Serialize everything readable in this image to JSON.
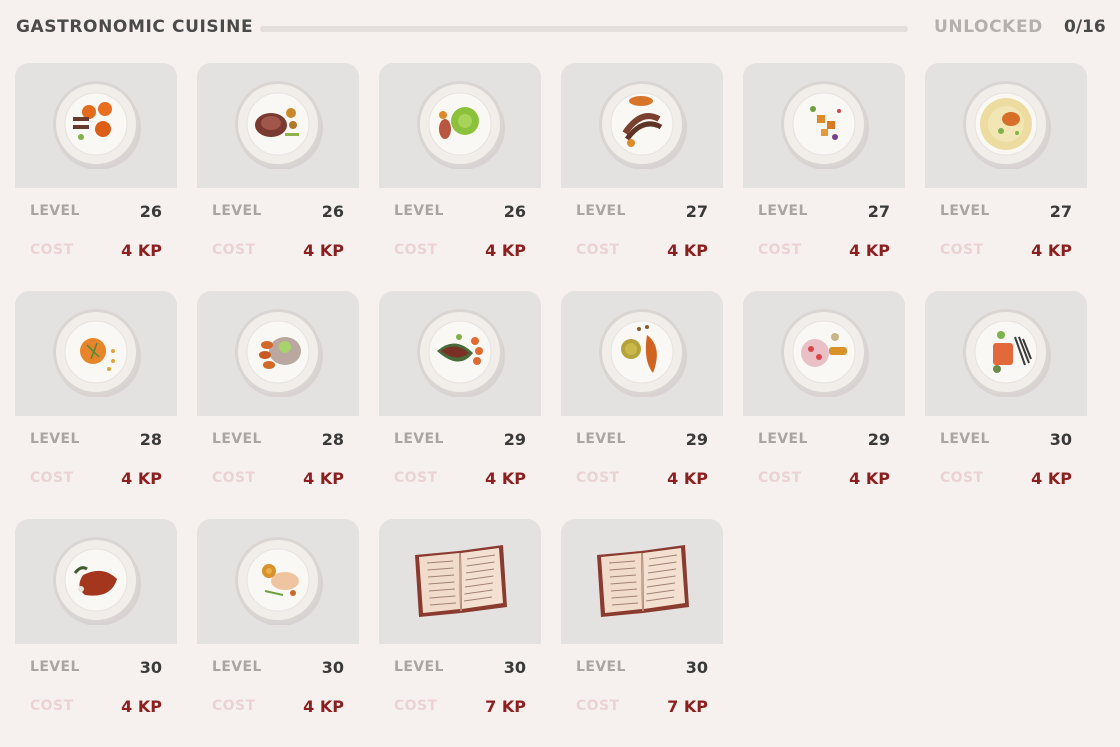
{
  "header": {
    "title": "GASTRONOMIC CUISINE",
    "unlocked_label": "UNLOCKED",
    "unlocked_count": "0/16"
  },
  "labels": {
    "level": "LEVEL",
    "cost": "COST"
  },
  "colors": {
    "background": "#f6f1ee",
    "card": "#e4e1e1",
    "cost_value": "#8c1f1f",
    "cost_label": "#ead3d3",
    "level_label": "#aaa5a3"
  },
  "recipes": [
    {
      "level": "26",
      "cost": "4 KP",
      "icon": "plate-orange-croquettes-icon"
    },
    {
      "level": "26",
      "cost": "4 KP",
      "icon": "plate-sliced-meat-icon"
    },
    {
      "level": "26",
      "cost": "4 KP",
      "icon": "plate-green-puree-icon"
    },
    {
      "level": "27",
      "cost": "4 KP",
      "icon": "plate-ribs-icon"
    },
    {
      "level": "27",
      "cost": "4 KP",
      "icon": "plate-small-bites-icon"
    },
    {
      "level": "27",
      "cost": "4 KP",
      "icon": "plate-creamy-soup-icon"
    },
    {
      "level": "28",
      "cost": "4 KP",
      "icon": "plate-orange-dome-icon"
    },
    {
      "level": "28",
      "cost": "4 KP",
      "icon": "plate-carrot-salad-icon"
    },
    {
      "level": "29",
      "cost": "4 KP",
      "icon": "plate-steak-icon"
    },
    {
      "level": "29",
      "cost": "4 KP",
      "icon": "plate-roast-chicken-icon"
    },
    {
      "level": "29",
      "cost": "4 KP",
      "icon": "plate-tart-icon"
    },
    {
      "level": "30",
      "cost": "4 KP",
      "icon": "plate-salmon-icon"
    },
    {
      "level": "30",
      "cost": "4 KP",
      "icon": "plate-glazed-meat-icon"
    },
    {
      "level": "30",
      "cost": "4 KP",
      "icon": "plate-fish-fillet-icon"
    },
    {
      "level": "30",
      "cost": "7 KP",
      "icon": "recipe-book-icon"
    },
    {
      "level": "30",
      "cost": "7 KP",
      "icon": "recipe-book-icon"
    }
  ]
}
